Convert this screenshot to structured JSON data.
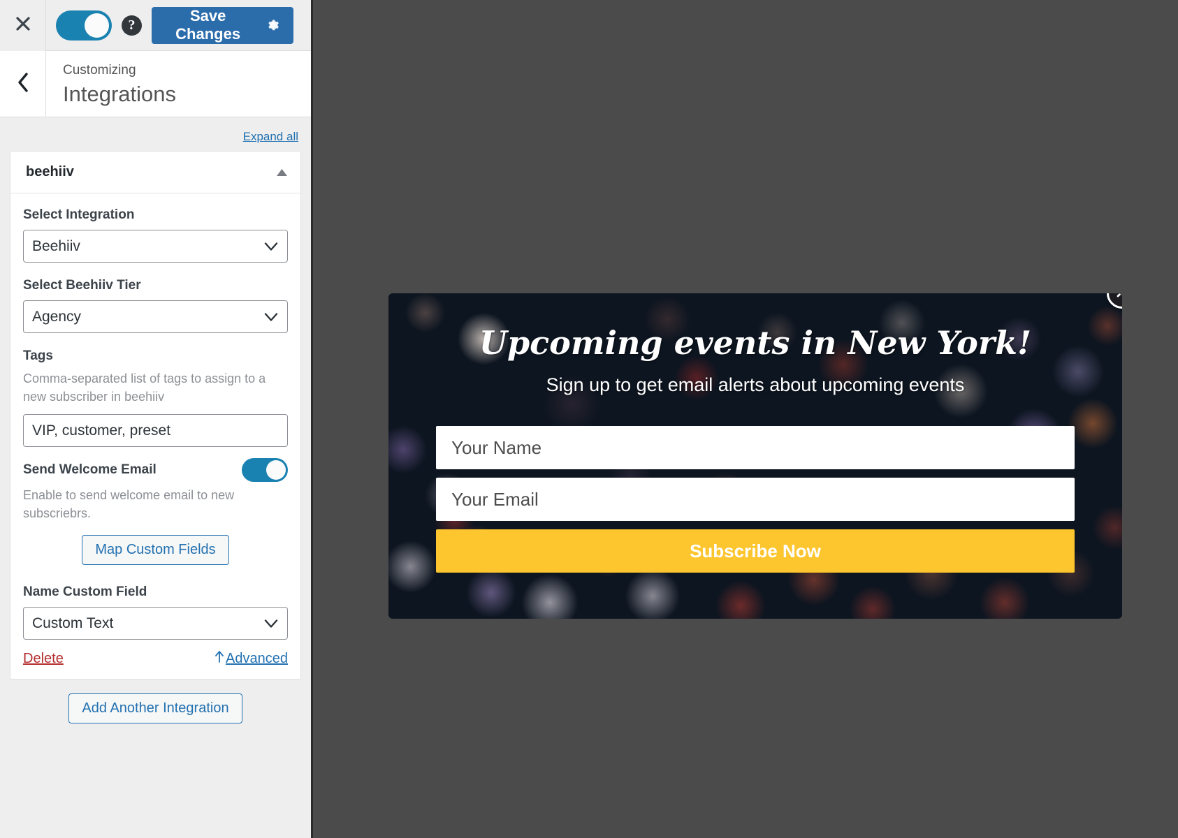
{
  "customizer": {
    "close_icon": "close-icon",
    "preview_toggle": "device-preview-toggle",
    "help_icon": "help-icon",
    "save_label": "Save Changes",
    "save_gear_icon": "gear-icon",
    "back_icon": "chevron-left-icon",
    "breadcrumb": "Customizing",
    "title": "Integrations",
    "expand_all": "Expand all",
    "accent_blue": "#2271b1",
    "save_button_blue": "#2b6cab",
    "toggle_on_blue": "#1a82b0",
    "delete_red": "#b32d2e"
  },
  "accordion": {
    "label": "beehiiv",
    "collapse_icon": "triangle-up-icon",
    "fields": {
      "select_integration_label": "Select Integration",
      "select_integration_value": "Beehiiv",
      "select_integration_options": [
        "Beehiiv"
      ],
      "tier_label": "Select Beehiiv Tier",
      "tier_value": "Agency",
      "tier_options": [
        "Agency"
      ],
      "tags_label": "Tags",
      "tags_desc": "Comma-separated list of tags to assign to a new subscriber in beehiiv",
      "tags_value": "VIP, customer, preset",
      "welcome_email_label": "Send Welcome Email",
      "welcome_email_desc": "Enable to send welcome email to new subscriebrs.",
      "welcome_email_on": true,
      "map_custom_fields_label": "Map Custom Fields",
      "name_custom_field_label": "Name Custom Field",
      "name_custom_field_value": "Custom Text",
      "name_custom_field_options": [
        "Custom Text"
      ],
      "delete_label": "Delete",
      "advanced_label": "Advanced",
      "advanced_icon": "arrow-up-icon"
    }
  },
  "footer": {
    "add_integration_label": "Add Another Integration"
  },
  "popup": {
    "title": "Upcoming events in New York!",
    "subtitle": "Sign up to get email alerts about upcoming events",
    "name_placeholder": "Your Name",
    "name_value": "",
    "email_placeholder": "Your Email",
    "email_value": "",
    "cta_label": "Subscribe Now",
    "close_icon": "close-icon",
    "cta_color": "#fdc52e",
    "background_color": "#0d1520"
  }
}
